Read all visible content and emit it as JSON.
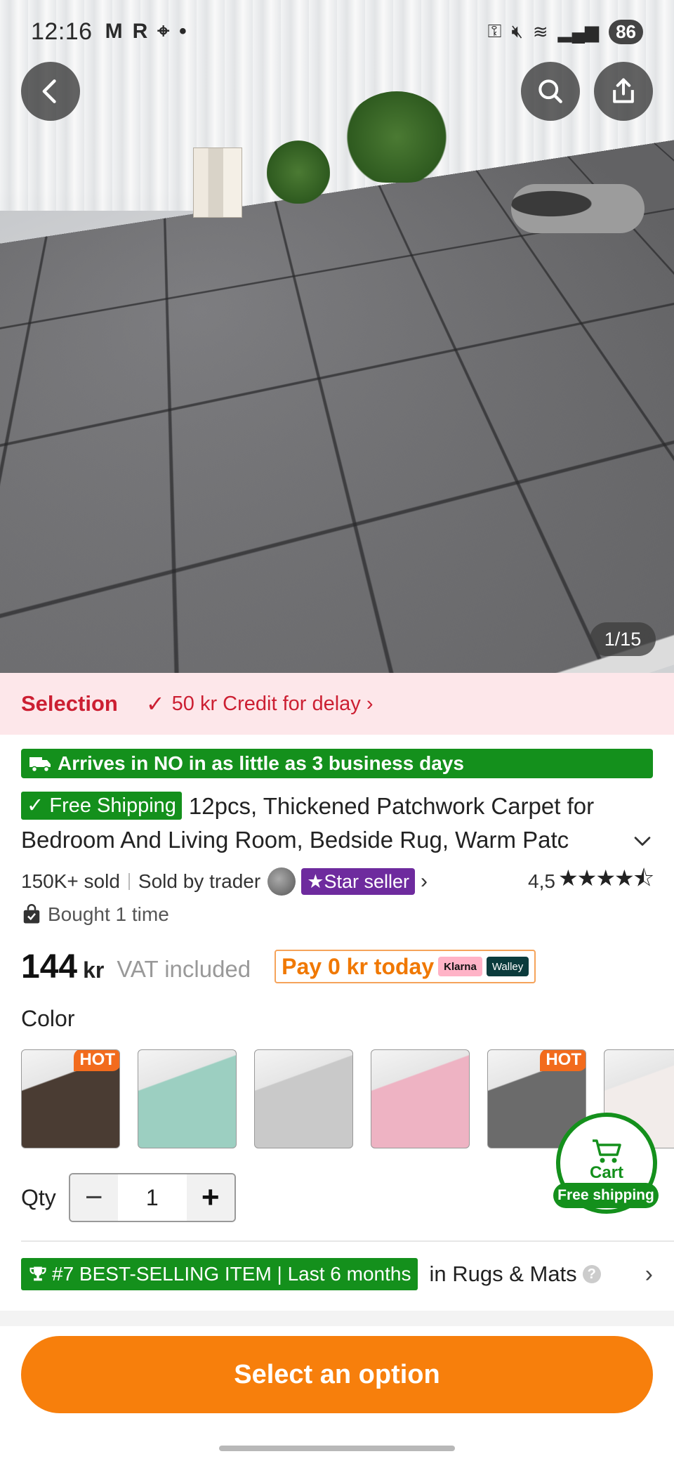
{
  "status_bar": {
    "time": "12:16",
    "left_icons": [
      "M",
      "R"
    ],
    "battery": "86"
  },
  "gallery": {
    "counter": "1/15"
  },
  "selection_banner": {
    "label": "Selection",
    "credit": "50 kr Credit for delay ›"
  },
  "delivery": {
    "text": "Arrives in NO in as little as 3 business days"
  },
  "product": {
    "free_shipping_badge": "Free Shipping",
    "title_line1": "12pcs, Thickened Patchwork Carpet for",
    "title_line2": "Bedroom And Living Room, Bedside Rug, Warm Patc",
    "sold": "150K+ sold",
    "sold_by": "Sold by trader",
    "star_seller": "Star seller",
    "rating": "4,5",
    "bought": "Bought 1 time",
    "price": "144",
    "currency": "kr",
    "vat": "VAT included",
    "pay_today": "Pay 0 kr today",
    "klarna": "Klarna",
    "walley": "Walley"
  },
  "color": {
    "label": "Color",
    "swatches": [
      {
        "hot": "HOT",
        "tone": "#4a3c33"
      },
      {
        "hot": "",
        "tone": "#9ccfc1"
      },
      {
        "hot": "",
        "tone": "#c9c9c9"
      },
      {
        "hot": "",
        "tone": "#eeb3c3"
      },
      {
        "hot": "HOT",
        "tone": "#6b6b6b"
      },
      {
        "hot": "",
        "tone": "#f2ecea"
      }
    ]
  },
  "cart": {
    "label": "Cart",
    "free_shipping": "Free shipping"
  },
  "quantity": {
    "label": "Qty",
    "value": "1",
    "minus": "−",
    "plus": "+"
  },
  "bestseller": {
    "badge": "#7 BEST-SELLING ITEM | Last 6 months",
    "category": "in Rugs & Mats",
    "help": "?"
  },
  "cta": {
    "label": "Select an option"
  }
}
